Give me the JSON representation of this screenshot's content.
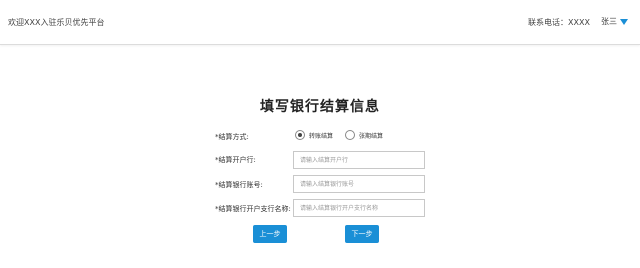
{
  "header": {
    "welcome": "欢迎XXX入驻乐贝优先平台",
    "contact": "联系电话：XXXX",
    "username": "张三"
  },
  "title": "填写银行结算信息",
  "form": {
    "settlement_method": {
      "label": "*结算方式:",
      "options": [
        "转账结算",
        "张期结算"
      ],
      "selected": "转账结算"
    },
    "account_holder": {
      "label": "*结算开户行:",
      "placeholder": "请输入结算开户行",
      "value": ""
    },
    "account_number": {
      "label": "*结算银行账号:",
      "placeholder": "请输入结算银行账号",
      "value": ""
    },
    "branch_name": {
      "label": "*结算银行开户支行名称:",
      "placeholder": "请输入结算银行开户支行名称",
      "value": ""
    }
  },
  "buttons": {
    "prev": "上一步",
    "next": "下一步"
  },
  "colors": {
    "accent": "#1a8fd6"
  },
  "icons": {
    "user_menu": "caret-down-icon"
  }
}
